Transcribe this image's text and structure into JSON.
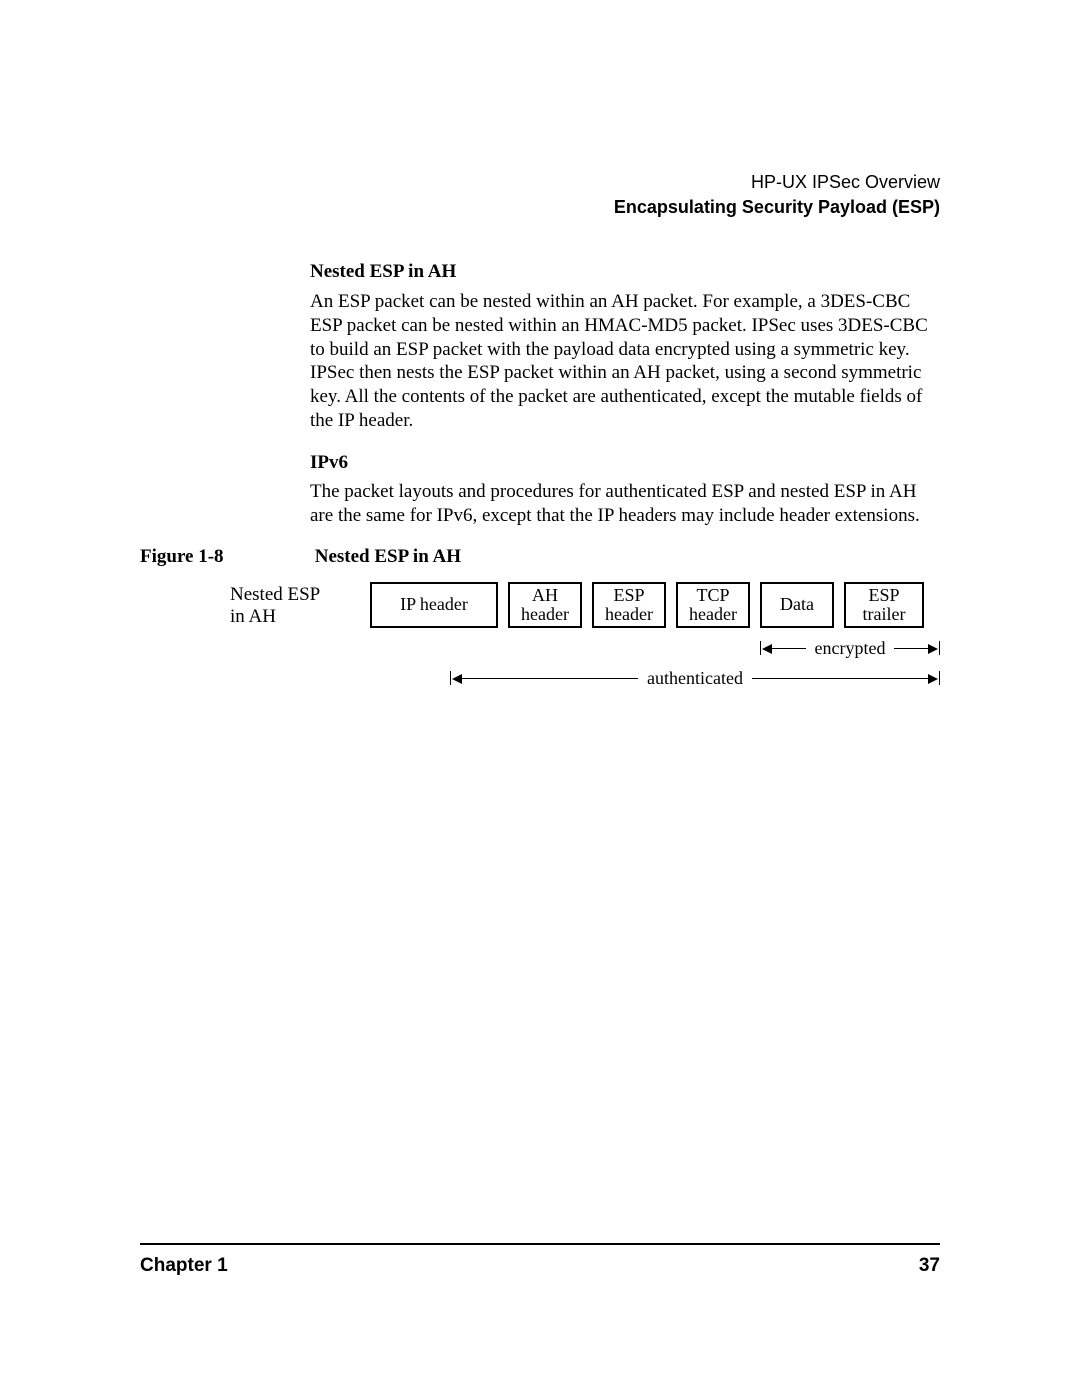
{
  "header": {
    "line1": "HP-UX IPSec Overview",
    "line2": "Encapsulating Security Payload (ESP)"
  },
  "sections": {
    "nested_title": "Nested ESP in AH",
    "nested_para": "An ESP packet can be nested within an AH packet. For example, a 3DES-CBC ESP packet can be nested within an HMAC-MD5 packet. IPSec uses 3DES-CBC to build an ESP packet with the payload data encrypted using a symmetric key. IPSec then nests the ESP packet within an AH packet, using a second symmetric key. All the contents of the packet are authenticated, except the mutable fields of the IP header.",
    "ipv6_title": "IPv6",
    "ipv6_para": "The packet layouts and procedures for authenticated ESP and nested ESP in AH are the same for IPv6, except that the IP headers may include header extensions."
  },
  "figure": {
    "number": "Figure 1-8",
    "caption": "Nested ESP in AH",
    "row_label_1": "Nested ESP",
    "row_label_2": "in AH",
    "cells": {
      "ip": "IP header",
      "ah1": "AH",
      "ah2": "header",
      "esp1": "ESP",
      "esp2": "header",
      "tcp1": "TCP",
      "tcp2": "header",
      "data": "Data",
      "tr1": "ESP",
      "tr2": "trailer"
    },
    "span_encrypted": "encrypted",
    "span_authenticated": "authenticated"
  },
  "footer": {
    "chapter": "Chapter 1",
    "page": "37"
  }
}
